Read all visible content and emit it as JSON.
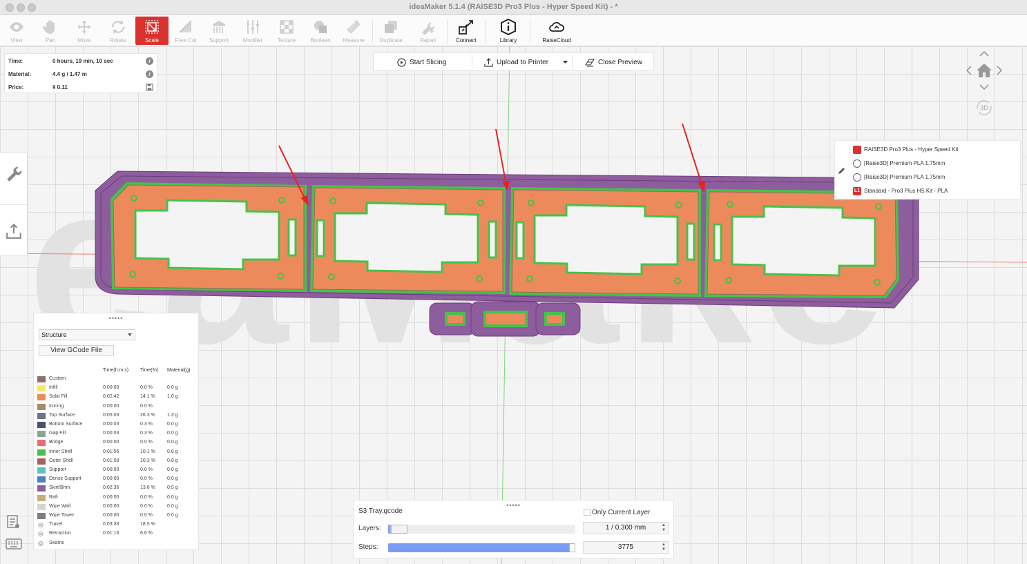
{
  "window": {
    "title": "ideaMaker 5.1.4 (RAISE3D Pro3 Plus - Hyper Speed Kit) - *"
  },
  "toolbar": {
    "tools": [
      {
        "label": "View"
      },
      {
        "label": "Pan"
      },
      {
        "label": "Move"
      },
      {
        "label": "Rotate"
      },
      {
        "label": "Scale"
      },
      {
        "label": "Free Cut"
      },
      {
        "label": "Support"
      },
      {
        "label": "Modifier"
      },
      {
        "label": "Texture"
      },
      {
        "label": "Boolean"
      },
      {
        "label": "Measure"
      },
      {
        "label": "Duplicate"
      },
      {
        "label": "Repair"
      },
      {
        "label": "Connect"
      },
      {
        "label": "Library"
      },
      {
        "label": "RaiseCloud"
      }
    ]
  },
  "info": {
    "time_label": "Time:",
    "time_value": "0 hours, 19 min, 10 sec",
    "material_label": "Material:",
    "material_value": "4.4 g / 1.47 m",
    "price_label": "Price:",
    "price_value": "¥ 0.11"
  },
  "actions": {
    "start_slicing": "Start Slicing",
    "upload": "Upload to Printer",
    "close_preview": "Close Preview"
  },
  "watermark": "eaMake",
  "nav": {
    "mode_3d": "3D"
  },
  "profile": {
    "printer": "RAISE3D Pro3 Plus - Hyper Speed Kit",
    "filament1": "[Raise3D] Premium PLA 1.75mm",
    "filament2": "[Raise3D] Premium PLA 1.75mm",
    "template": "Standard - Pro3 Plus HS Kit - PLA",
    "template_badge": "L1"
  },
  "structure": {
    "grip": "•••••",
    "view_mode": "Structure",
    "view_gcode": "View GCode File",
    "headers": {
      "time": "Time(h:m:s)",
      "percent": "Time(%)",
      "material": "Material(g)"
    },
    "rows": [
      {
        "name": "Custom",
        "time": "",
        "pct": "",
        "mat": "",
        "color": "#8a7066"
      },
      {
        "name": "Infill",
        "time": "0:00:00",
        "pct": "0.0 %",
        "mat": "0.0 g",
        "color": "#f3ea5f"
      },
      {
        "name": "Solid Fill",
        "time": "0:02:42",
        "pct": "14.1 %",
        "mat": "1.0 g",
        "color": "#ec8a5c"
      },
      {
        "name": "Ironing",
        "time": "0:00:00",
        "pct": "0.0 %",
        "mat": "",
        "color": "#a88c6a"
      },
      {
        "name": "Top Surface",
        "time": "0:05:03",
        "pct": "26.3 %",
        "mat": "1.3 g",
        "color": "#6f7580"
      },
      {
        "name": "Bottom Surface",
        "time": "0:00:03",
        "pct": "0.3 %",
        "mat": "0.0 g",
        "color": "#4a5170"
      },
      {
        "name": "Gap Fill",
        "time": "0:00:03",
        "pct": "0.3 %",
        "mat": "0.0 g",
        "color": "#8aa78e"
      },
      {
        "name": "Bridge",
        "time": "0:00:00",
        "pct": "0.0 %",
        "mat": "0.0 g",
        "color": "#ef6b73"
      },
      {
        "name": "Inner Shell",
        "time": "0:01:56",
        "pct": "10.1 %",
        "mat": "0.8 g",
        "color": "#46c24a"
      },
      {
        "name": "Outer Shell",
        "time": "0:01:58",
        "pct": "10.3 %",
        "mat": "0.8 g",
        "color": "#a0665e"
      },
      {
        "name": "Support",
        "time": "0:00:00",
        "pct": "0.0 %",
        "mat": "0.0 g",
        "color": "#5bc1c6"
      },
      {
        "name": "Dense Support",
        "time": "0:00:00",
        "pct": "0.0 %",
        "mat": "0.0 g",
        "color": "#4f7fc2"
      },
      {
        "name": "Skirt/Brim",
        "time": "0:02:36",
        "pct": "13.6 %",
        "mat": "0.5 g",
        "color": "#8e5d9d"
      },
      {
        "name": "Raft",
        "time": "0:00:00",
        "pct": "0.0 %",
        "mat": "0.0 g",
        "color": "#c5b07a"
      },
      {
        "name": "Wipe Wall",
        "time": "0:00:00",
        "pct": "0.0 %",
        "mat": "0.0 g",
        "color": "#d5d5d5"
      },
      {
        "name": "Wipe Tower",
        "time": "0:00:00",
        "pct": "0.0 %",
        "mat": "0.0 g",
        "color": "#7e7e7e"
      },
      {
        "name": "Travel",
        "time": "0:03:33",
        "pct": "18.5 %",
        "mat": "",
        "color": ""
      },
      {
        "name": "Retraction",
        "time": "0:01:16",
        "pct": "6.6 %",
        "mat": "",
        "color": ""
      },
      {
        "name": "Seams",
        "time": "",
        "pct": "",
        "mat": "",
        "color": ""
      }
    ]
  },
  "gcode": {
    "grip": "•••••",
    "file": "S3 Tray.gcode",
    "only_current_layer": "Only Current Layer",
    "layers_label": "Layers:",
    "layers_value": "1 / 0.300 mm",
    "steps_label": "Steps:",
    "steps_value": "3775",
    "layer_fraction": 0.02,
    "steps_fraction": 1.0
  },
  "colors": {
    "accent": "#d9322f",
    "skirt": "#8e5d9d",
    "solid_fill": "#ec8a5c",
    "inner_shell": "#46c24a",
    "outer_shell": "#a0665e",
    "arrow": "#e8231d"
  }
}
